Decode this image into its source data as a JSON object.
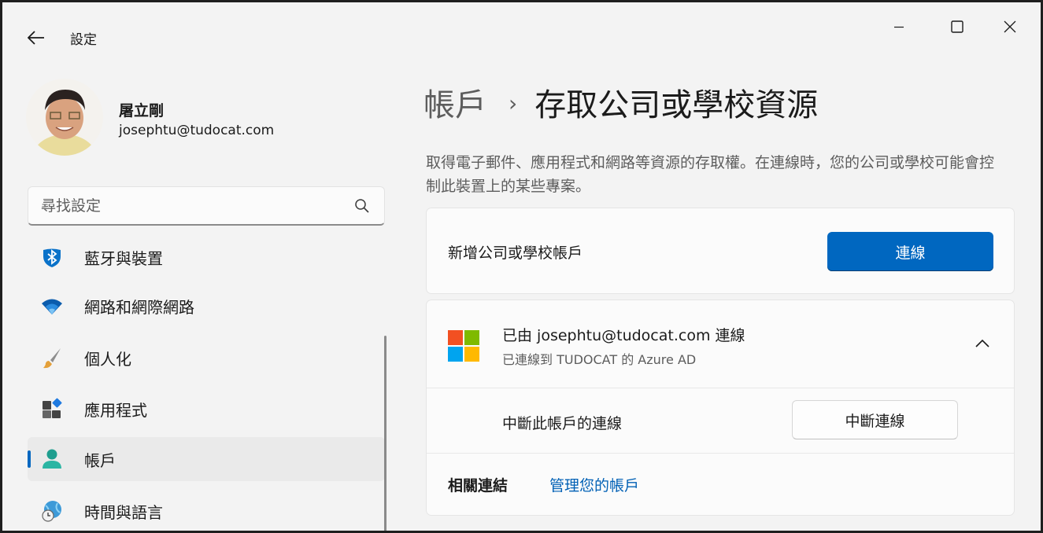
{
  "window": {
    "title": "設定"
  },
  "user": {
    "name": "屠立剛",
    "email": "josephtu@tudocat.com"
  },
  "search": {
    "placeholder": "尋找設定"
  },
  "nav": {
    "items": [
      {
        "label": "藍牙與裝置",
        "icon": "bluetooth-icon"
      },
      {
        "label": "網路和網際網路",
        "icon": "wifi-icon"
      },
      {
        "label": "個人化",
        "icon": "paintbrush-icon"
      },
      {
        "label": "應用程式",
        "icon": "apps-icon"
      },
      {
        "label": "帳戶",
        "icon": "accounts-icon",
        "selected": true
      },
      {
        "label": "時間與語言",
        "icon": "globe-clock-icon"
      }
    ]
  },
  "breadcrumb": {
    "parent": "帳戶",
    "separator": "›",
    "current": "存取公司或學校資源"
  },
  "description": "取得電子郵件、應用程式和網路等資源的存取權。在連線時，您的公司或學校可能會控制此裝置上的某些專案。",
  "add_account": {
    "label": "新增公司或學校帳戶",
    "button": "連線"
  },
  "account": {
    "title": "已由 josephtu@tudocat.com 連線",
    "subtitle": "已連線到 TUDOCAT 的 Azure AD",
    "disconnect_label": "中斷此帳戶的連線",
    "disconnect_button": "中斷連線"
  },
  "related": {
    "label": "相關連結",
    "link": "管理您的帳戶"
  },
  "colors": {
    "accent": "#0067c0",
    "link": "#0060b5",
    "background": "#f3f3f3",
    "card": "#fbfbfb"
  }
}
